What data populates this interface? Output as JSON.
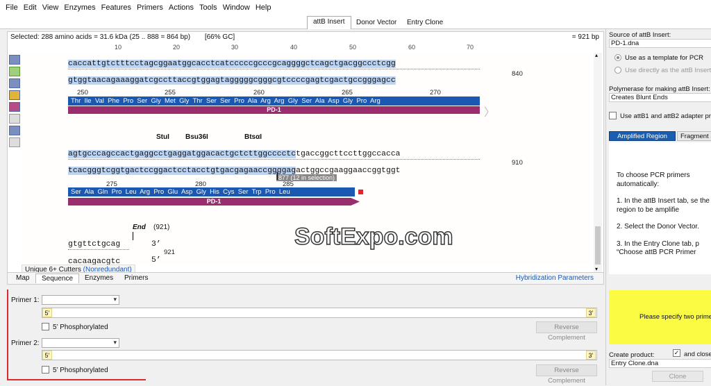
{
  "menu": [
    "File",
    "Edit",
    "View",
    "Enzymes",
    "Features",
    "Primers",
    "Actions",
    "Tools",
    "Window",
    "Help"
  ],
  "tabs": [
    "attB Insert",
    "Donor Vector",
    "Entry Clone"
  ],
  "status": {
    "selected": "Selected:  288 amino acids  = 31.6 kDa  (25 .. 888  =  864 bp)",
    "gc": "[66% GC]",
    "length": "921 bp"
  },
  "ruler": [
    "10",
    "20",
    "30",
    "40",
    "50",
    "60",
    "70"
  ],
  "seq": {
    "block1": {
      "top": "caccattgtctttcctagcggaatggcacctcatcccccgcccgcaggggctcagctgacggccctcgg",
      "bottom": "gtggtaacagaaaggatcgccttaccgtggagtagggggcgggcgtccccgagtcgactgccgggagcc",
      "num": "840",
      "positions": [
        "250",
        "255",
        "260",
        "265",
        "270"
      ],
      "aa": "Thr  Ile  Val  Phe  Pro  Ser  Gly  Met  Gly  Thr  Ser  Ser  Pro  Ala  Arg  Arg  Gly  Ser  Ala  Asp  Gly  Pro  Arg",
      "feature": "PD-1"
    },
    "block2": {
      "enzymes": [
        "StuI",
        "Bsu36I",
        "BtsαI"
      ],
      "top_sel": "agtgcccagccactgaggcctgaggatggacactgctcttggcccctc",
      "top_rest": "tgaccggcttccttggccacca",
      "bottom_sel": "tcacgggtcggtgactccggactcctacctgtgacgagaaccggggag",
      "bottom_rest": "actggccgaaggaaccggtggt",
      "num": "910",
      "positions": [
        "275",
        "280",
        "285"
      ],
      "aa": "Ser  Ala  Gln  Pro  Leu  Arg  Pro  Glu  Asp  Gly  His  Cys  Ser  Trp  Pro  Leu",
      "feature": "PD-1",
      "tooltip": "877  (12 in selection)"
    },
    "block3": {
      "end": "End",
      "end_num": "(921)",
      "top": "gtgttctgcag",
      "bottom": "cacaagacgtc",
      "three": "3’",
      "five": "5’",
      "num": "921"
    }
  },
  "cutters": {
    "label": "Unique 6+ Cutters",
    "mode": "(Nonredundant)"
  },
  "subtabs": [
    "Map",
    "Sequence",
    "Enzymes",
    "Primers"
  ],
  "hybridization": "Hybridization Parameters",
  "primer1": {
    "label": "Primer 1:",
    "five": "5’",
    "three": "3’",
    "phos": "5’ Phosphorylated",
    "rc": "Reverse Complement"
  },
  "primer2": {
    "label": "Primer 2:",
    "five": "5’",
    "three": "3’",
    "phos": "5’ Phosphorylated",
    "rc": "Reverse Complement"
  },
  "right": {
    "source_label": "Source of attB Insert:",
    "source_value": "PD-1.dna",
    "opt1": "Use as a template for PCR",
    "opt2": "Use directly as the attB Insert",
    "poly_label": "Polymerase for making attB Insert:",
    "poly_value": "Creates Blunt Ends",
    "adapter": "Use attB1 and attB2 adapter prim",
    "tab_a": "Amplified Region",
    "tab_b": "Fragment S",
    "instr_title": "To choose PCR primers automatically:",
    "steps": [
      "1. In the attB Insert tab, se the region to be amplifie",
      "2. Select the Donor Vector.",
      "3. In the Entry Clone tab, p “Choose attB PCR Primer"
    ],
    "yellow": "Please specify two primers",
    "create_label": "Create product:",
    "and_close": "and close",
    "create_value": "Entry Clone.dna",
    "clone_btn": "Clone"
  },
  "watermark": "SoftExpo.com"
}
